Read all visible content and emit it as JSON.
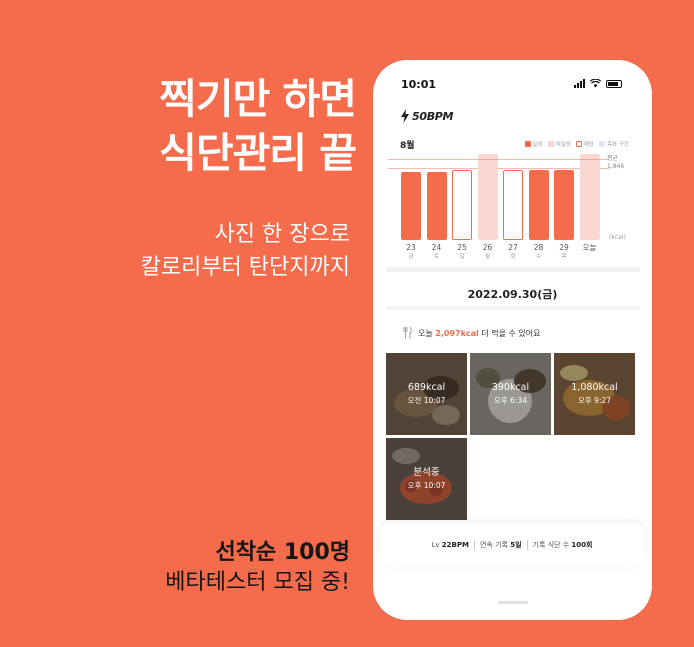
{
  "ad": {
    "headline": [
      "찍기만 하면",
      "식단관리 끝"
    ],
    "subline": [
      "사진 한 장으로",
      "칼로리부터 탄단지까지"
    ],
    "promo_bold": "선착순 100명",
    "promo_text": "베타테스터 모집 중!"
  },
  "status_bar": {
    "time": "10:01"
  },
  "app": {
    "logo": "50BPM",
    "month": "8월",
    "legend": [
      {
        "label": "달성",
        "color": "#f56c4d"
      },
      {
        "label": "미달성",
        "color": "#fbd4cc"
      },
      {
        "label": "예상",
        "color": "#ffffff"
      },
      {
        "label": "목표 구간",
        "color": "#dfe6f5"
      }
    ],
    "avg_label": "평균",
    "avg_value": "1,846",
    "kcal_unit": "(kcal)",
    "date": "2022.09.30(금)",
    "remain": {
      "prefix": "오늘 ",
      "value": "2,097kcal",
      "suffix": " 더 먹을 수 있어요"
    },
    "meals": [
      {
        "kcal": "689kcal",
        "time": "오전 10:07"
      },
      {
        "kcal": "390kcal",
        "time": "오후 6:34"
      },
      {
        "kcal": "1,080kcal",
        "time": "오후 9:27"
      },
      {
        "kcal": "분석중",
        "time": "오후 10:07"
      }
    ],
    "stats": {
      "level_prefix": "Lv ",
      "level": "22BPM",
      "streak_prefix": "연속 기록 ",
      "streak": "5일",
      "count_prefix": "기록 식단 수 ",
      "count": "100회"
    }
  },
  "chart_data": {
    "type": "bar",
    "categories": [
      "23",
      "24",
      "25",
      "26",
      "27",
      "28",
      "29",
      "오늘"
    ],
    "weekdays": [
      "금",
      "토",
      "일",
      "월",
      "화",
      "수",
      "목",
      ""
    ],
    "values": [
      1750,
      1750,
      1800,
      2200,
      1800,
      1800,
      1800,
      2200
    ],
    "status": [
      "achieved",
      "achieved",
      "expected",
      "missed",
      "expected",
      "achieved",
      "achieved",
      "missed"
    ],
    "average": 1846,
    "ylabel": "(kcal)",
    "ylim": [
      0,
      2300
    ]
  }
}
